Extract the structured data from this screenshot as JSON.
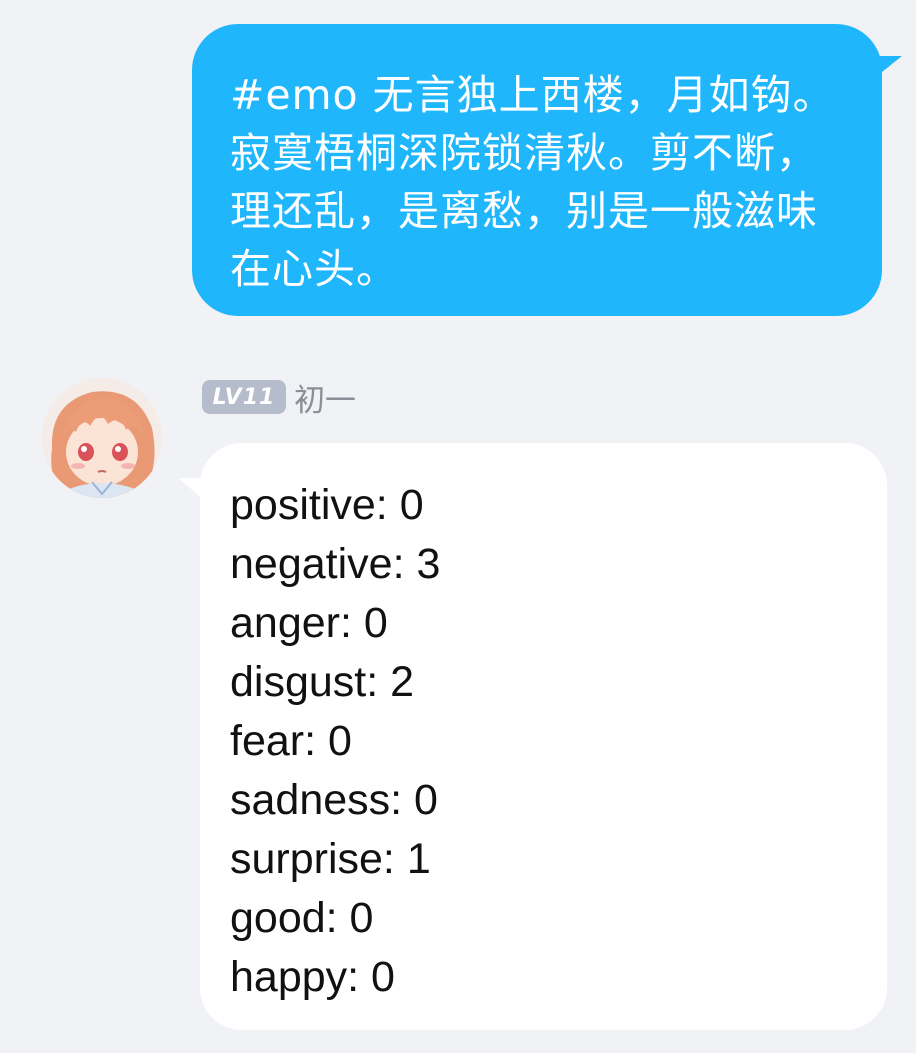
{
  "outgoing": {
    "text": "#emo 无言独上西楼，月如钩。寂寞梧桐深院锁清秋。剪不断，理还乱，是离愁，别是一般滋味在心头。"
  },
  "incoming": {
    "level_badge": "LV11",
    "sender_name": "初一",
    "avatar_icon": "anime-girl-avatar",
    "lines": [
      "positive: 0",
      "negative: 3",
      "anger: 0",
      "disgust: 2",
      "fear: 0",
      "sadness: 0",
      "surprise: 1",
      "good: 0",
      "happy: 0"
    ]
  },
  "colors": {
    "background": "#f1f2f6",
    "outgoing_bubble": "#1fb6fb",
    "incoming_bubble": "#ffffff",
    "badge": "#b5bccb"
  }
}
